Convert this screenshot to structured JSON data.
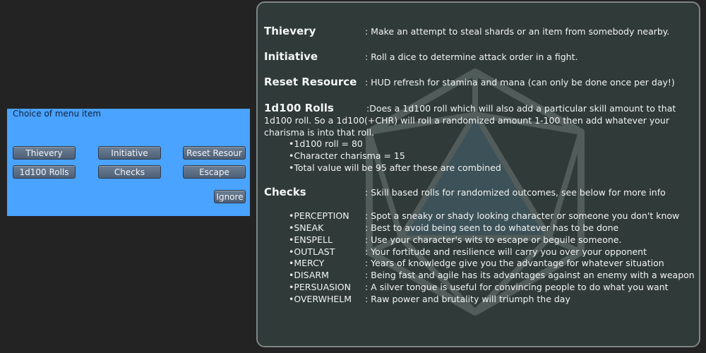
{
  "dialog": {
    "prompt": "Choice of menu item",
    "buttons": {
      "thievery": "Thievery",
      "initiative": "Initiative",
      "reset": "Reset Resour",
      "rolls": "1d100 Rolls",
      "checks": "Checks",
      "escape": "Escape",
      "ignore": "Ignore"
    }
  },
  "panel": {
    "thievery": {
      "title": "Thievery",
      "desc": ": Make an attempt to steal shards or an item from somebody nearby."
    },
    "initiative": {
      "title": "Initiative",
      "desc": ": Roll a dice to determine attack order in a fight."
    },
    "reset": {
      "title": "Reset Resource",
      "desc": ": HUD refresh for stamina and mana (can only be done once per day!)"
    },
    "rolls": {
      "title": "1d100 Rolls",
      "desc": ":Does a 1d100 roll which will also add a particular skill amount to that 1d100 roll. So a 1d100(+CHR) will roll a randomized amount 1-100 then add whatever your charisma is into that roll.",
      "examples": [
        "•1d100 roll = 80",
        "•Character charisma = 15",
        "•Total value will be 95 after these are combined"
      ]
    },
    "checks": {
      "title": "Checks",
      "desc": ": Skill based rolls for randomized outcomes, see below for more info",
      "items": [
        {
          "name": "•PERCEPTION",
          "desc": ": Spot a sneaky or shady looking character or someone you don't know"
        },
        {
          "name": "•SNEAK",
          "desc": ": Best to avoid being seen to do whatever has to be done"
        },
        {
          "name": "•ENSPELL",
          "desc": ": Use your character's wits to escape or beguile someone."
        },
        {
          "name": "•OUTLAST",
          "desc": ": Your fortitude and resilience will carry you over your opponent"
        },
        {
          "name": "•MERCY",
          "desc": ": Years of knowledge give you the advantage for whatever situation"
        },
        {
          "name": "•DISARM",
          "desc": ": Being fast and agile has its advantages against an enemy with a weapon"
        },
        {
          "name": "•PERSUASION",
          "desc": ": A silver tongue is useful for convincing people to do what you want"
        },
        {
          "name": "•OVERWHELM",
          "desc": ": Raw power and brutality will triumph the day"
        }
      ]
    }
  }
}
